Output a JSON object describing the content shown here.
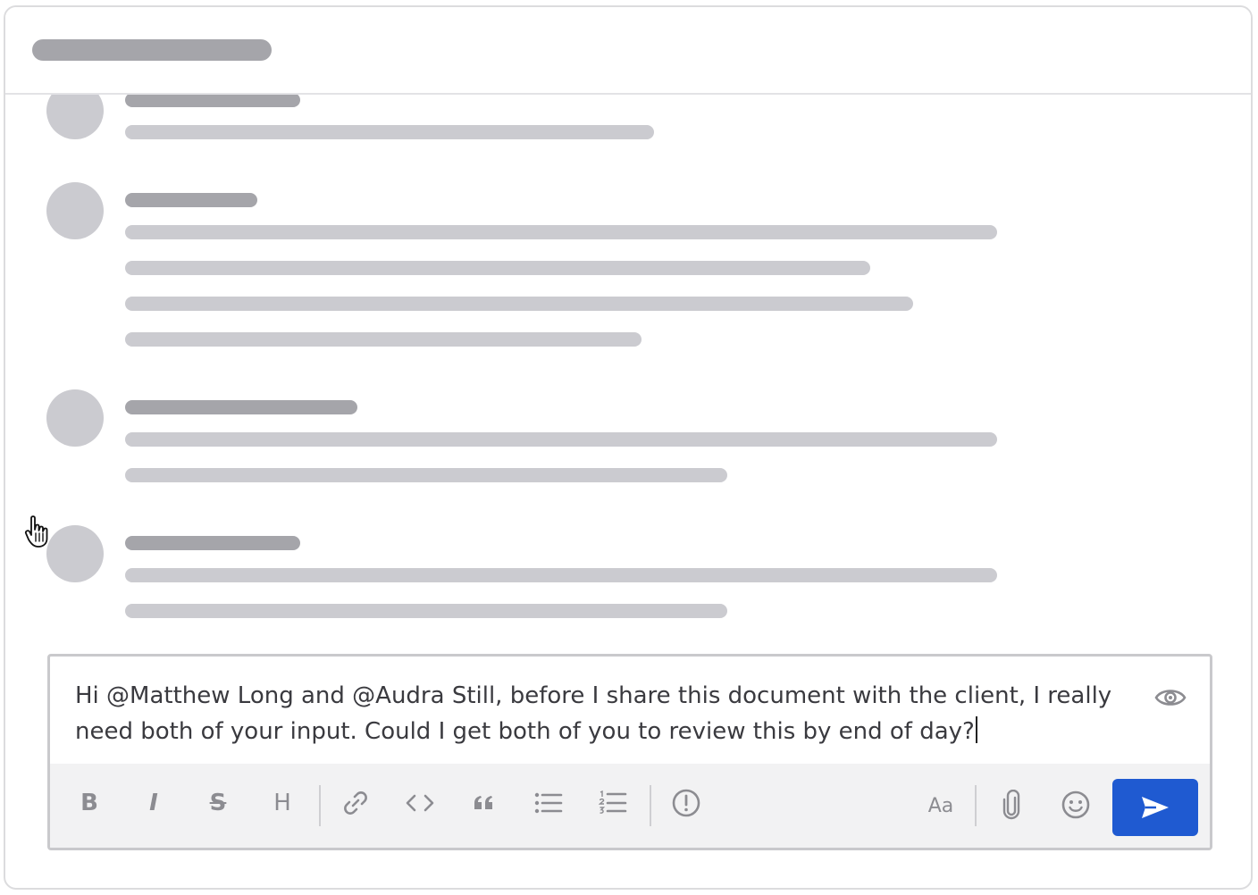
{
  "composer": {
    "message": "Hi @Matthew Long and @Audra Still, before I share this document with the client, I really need both of your input. Could I get both of you to review this by end of day?"
  },
  "toolbar": {
    "bold": "B",
    "italic": "I",
    "strikethrough": "S",
    "heading": "H",
    "font_toggle": "Aa"
  },
  "icons": {
    "preview": "eye-icon",
    "bold": "bold-icon",
    "italic": "italic-icon",
    "strikethrough": "strikethrough-icon",
    "heading": "heading-icon",
    "link": "link-icon",
    "code": "code-icon",
    "quote": "quote-icon",
    "bullet_list": "bullet-list-icon",
    "numbered_list": "numbered-list-icon",
    "alert": "alert-icon",
    "attach": "paperclip-icon",
    "emoji": "emoji-icon",
    "send": "send-icon"
  },
  "colors": {
    "accent": "#1f5ad1",
    "skeleton_dark": "#a5a5aa",
    "skeleton_light": "#cbcbd0",
    "toolbar_bg": "#f2f2f3",
    "icon_gray": "#8c8c91"
  }
}
